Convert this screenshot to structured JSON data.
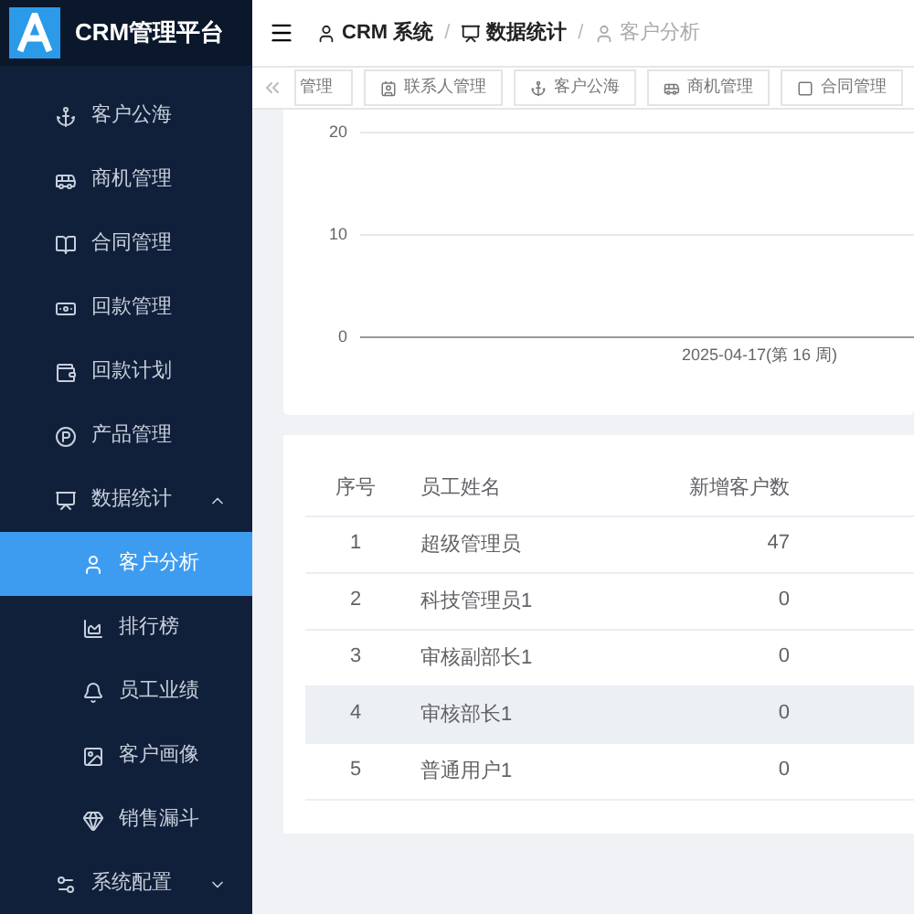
{
  "sidebar": {
    "title": "CRM管理平台",
    "items": [
      {
        "label": "客户公海",
        "selected": false
      },
      {
        "label": "商机管理",
        "selected": false
      },
      {
        "label": "合同管理",
        "selected": false
      },
      {
        "label": "回款管理",
        "selected": false
      },
      {
        "label": "回款计划",
        "selected": false
      },
      {
        "label": "产品管理",
        "selected": false
      },
      {
        "label": "数据统计",
        "selected": false,
        "expanded": true,
        "children": [
          {
            "label": "客户分析",
            "selected": true
          },
          {
            "label": "排行榜",
            "selected": false
          },
          {
            "label": "员工业绩",
            "selected": false
          },
          {
            "label": "客户画像",
            "selected": false
          },
          {
            "label": "销售漏斗",
            "selected": false
          }
        ]
      },
      {
        "label": "系统配置",
        "selected": false,
        "expanded": false
      }
    ]
  },
  "breadcrumb": [
    {
      "label": "CRM 系统",
      "current": false
    },
    {
      "separator": "/",
      "label": "数据统计",
      "current": false
    },
    {
      "separator": "/",
      "label": "客户分析",
      "current": true
    }
  ],
  "tabs": [
    {
      "label": "管理",
      "selected": false
    },
    {
      "label": "联系人管理",
      "selected": false
    },
    {
      "label": "客户公海",
      "selected": false
    },
    {
      "label": "商机管理",
      "selected": false
    },
    {
      "label": "合同管理",
      "selected": false
    }
  ],
  "chart": {
    "chart_data": {
      "type": "line",
      "categories": [
        "2025-04-17(第 16 周)"
      ],
      "ylim": [
        0,
        20
      ],
      "yticks": [
        0,
        10,
        20
      ]
    }
  },
  "table": {
    "columns": [
      "序号",
      "员工姓名",
      "新增客户数"
    ],
    "rows": [
      {
        "cells": [
          "1",
          "超级管理员",
          "47"
        ],
        "highlighted": false
      },
      {
        "cells": [
          "2",
          "科技管理员1",
          "0"
        ],
        "highlighted": false
      },
      {
        "cells": [
          "3",
          "审核副部长1",
          "0"
        ],
        "highlighted": false
      },
      {
        "cells": [
          "4",
          "审核部长1",
          "0"
        ],
        "highlighted": true
      },
      {
        "cells": [
          "5",
          "普通用户1",
          "0"
        ],
        "highlighted": false
      }
    ]
  }
}
